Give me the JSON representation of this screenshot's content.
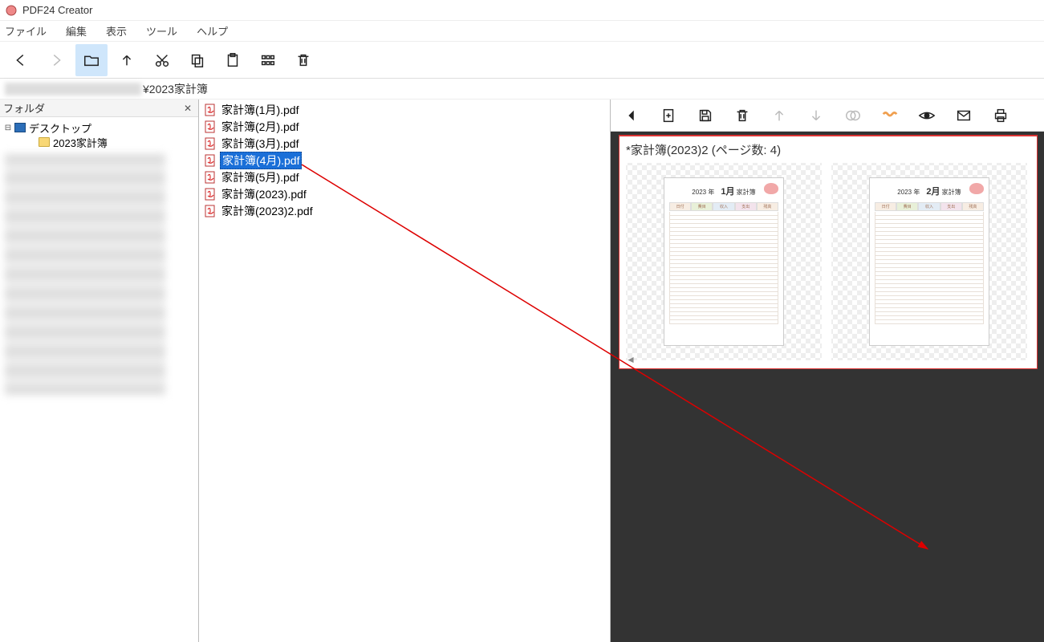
{
  "title": "PDF24 Creator",
  "menu": {
    "file": "ファイル",
    "edit": "編集",
    "view": "表示",
    "tools": "ツール",
    "help": "ヘルプ"
  },
  "breadcrumb_suffix": "¥2023家計簿",
  "folder_pane": {
    "header": "フォルダ",
    "desktop": "デスクトップ",
    "folder1": "2023家計簿"
  },
  "files": [
    {
      "name": "家計簿(1月).pdf"
    },
    {
      "name": "家計簿(2月).pdf"
    },
    {
      "name": "家計簿(3月).pdf"
    },
    {
      "name": "家計簿(4月).pdf",
      "selected": true
    },
    {
      "name": "家計簿(5月).pdf"
    },
    {
      "name": "家計簿(2023).pdf"
    },
    {
      "name": "家計簿(2023)2.pdf"
    }
  ],
  "preview": {
    "doc_title": "*家計簿(2023)2 (ページ数: 4)",
    "thumbs": [
      {
        "year": "2023 年",
        "month": "1月",
        "label": "家計簿"
      },
      {
        "year": "2023 年",
        "month": "2月",
        "label": "家計簿"
      }
    ],
    "col_headers": [
      "日付",
      "費目",
      "収入",
      "支出",
      "残高"
    ]
  }
}
